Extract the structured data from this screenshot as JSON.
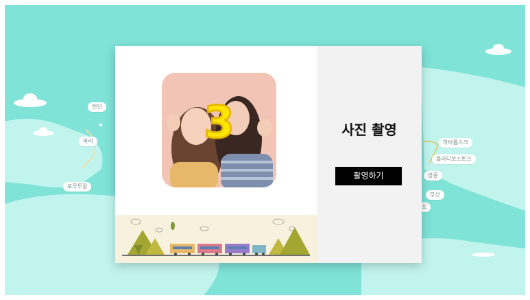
{
  "background": {
    "sea_color": "#7fe3d8",
    "land_color": "#c2f4ee",
    "cities_left": [
      "런던",
      "파리",
      "포루투갈"
    ],
    "cities_right": [
      "하바롭스크",
      "블라디보스토크",
      "강릉",
      "부산",
      "포"
    ]
  },
  "modal": {
    "countdown": "3",
    "title": "사진 촬영",
    "shoot_button_label": "촬영하기",
    "accent_color": "#ffe600"
  }
}
